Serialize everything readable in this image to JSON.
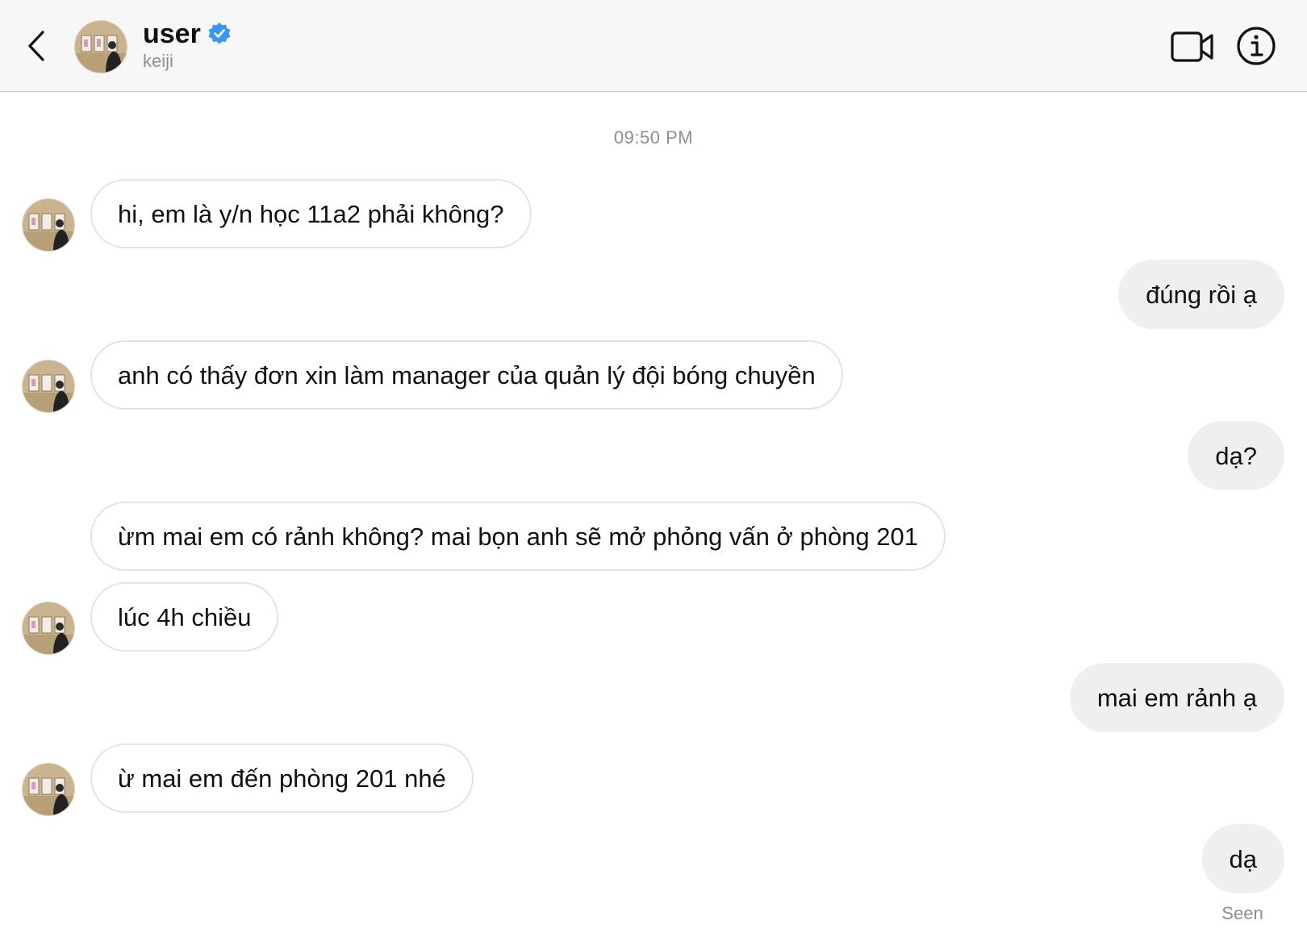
{
  "header": {
    "back_label": "back",
    "username": "user",
    "handle": "keiji",
    "verified_color": "#3897f0",
    "icons": [
      "chevron-left-icon",
      "avatar",
      "verified-badge-icon",
      "video-call-icon",
      "info-icon"
    ]
  },
  "thread": {
    "timestamp": "09:50 PM",
    "messages": [
      {
        "from": "them",
        "text": "hi, em là y/n học 11a2 phải không?"
      },
      {
        "from": "me",
        "text": "đúng rồi ạ"
      },
      {
        "from": "them",
        "text": "anh có thấy đơn xin làm manager của quản lý đội bóng chuyền"
      },
      {
        "from": "me",
        "text": "dạ?"
      },
      {
        "from": "them",
        "text": "ừm mai em có rảnh không? mai bọn anh sẽ mở phỏng vấn ở phòng 201"
      },
      {
        "from": "them",
        "text": "lúc 4h chiều"
      },
      {
        "from": "me",
        "text": "mai em rảnh ạ"
      },
      {
        "from": "them",
        "text": "ừ mai em đến phòng 201 nhé"
      },
      {
        "from": "me",
        "text": "dạ"
      }
    ],
    "seen_label": "Seen"
  },
  "colors": {
    "header_bg": "#f7f7f7",
    "incoming_border": "#e3e3e3",
    "outgoing_bg": "#efefef",
    "muted_text": "#8e8e8e"
  }
}
